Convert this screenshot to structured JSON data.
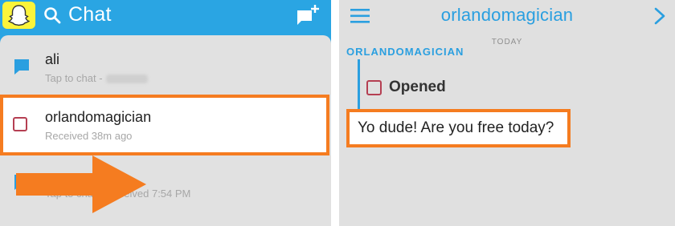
{
  "left": {
    "header": {
      "title": "Chat"
    },
    "conversations": [
      {
        "name": "ali",
        "subtitle": "Tap to chat -"
      },
      {
        "name": "orlandomagician",
        "subtitle": "Received 38m ago"
      },
      {
        "name": "",
        "subtitle": "Tap to chat - Received 7:54 PM"
      }
    ]
  },
  "right": {
    "header": {
      "title": "orlandomagician"
    },
    "day_label": "TODAY",
    "sender": "ORLANDOMAGICIAN",
    "status": "Opened",
    "message": "Yo dude! Are you free today?"
  },
  "colors": {
    "snapchat_blue": "#2aa5e3",
    "snapchat_yellow": "#fbf43b",
    "highlight_orange": "#f57c20",
    "opened_red": "#b53f52",
    "list_background": "#e1e1e1"
  },
  "icons": [
    "ghost-icon",
    "search-icon",
    "new-chat-icon",
    "chat-bubble-icon",
    "opened-square-icon",
    "arrow-icon",
    "hamburger-icon",
    "chevron-right-icon"
  ]
}
